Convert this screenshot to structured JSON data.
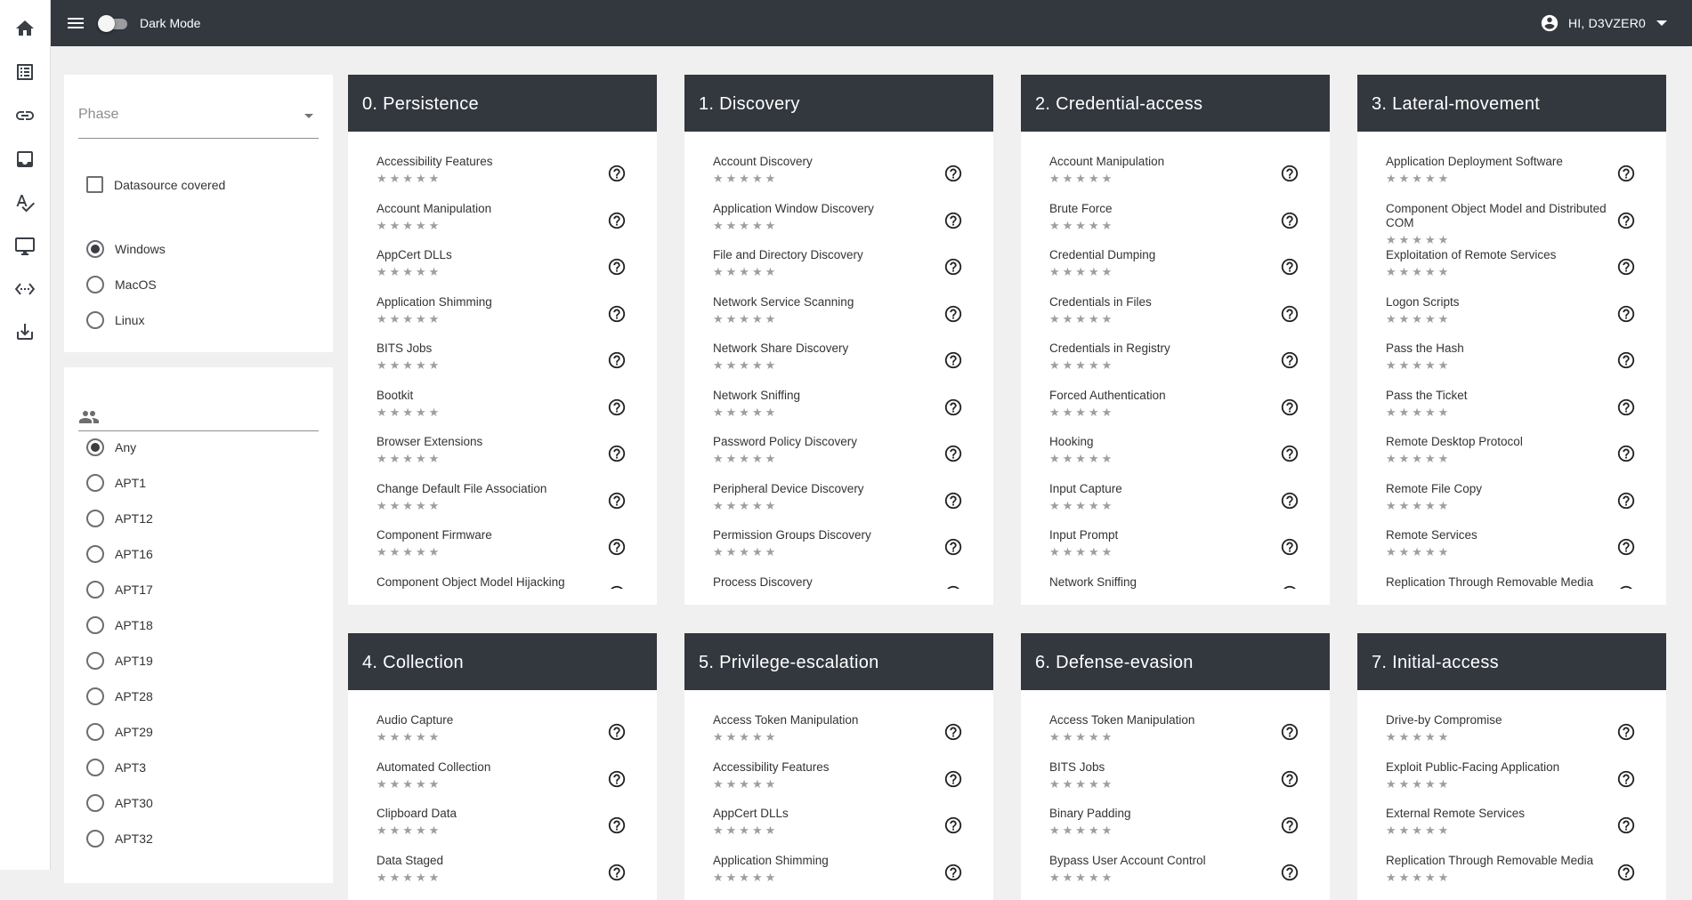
{
  "nav": {
    "items": [
      {
        "id": "home",
        "icon": "home-icon"
      },
      {
        "id": "list",
        "icon": "list-icon"
      },
      {
        "id": "link",
        "icon": "link-icon"
      },
      {
        "id": "inbox",
        "icon": "inbox-icon"
      },
      {
        "id": "spellcheck",
        "icon": "spellcheck-icon"
      },
      {
        "id": "desktop",
        "icon": "desktop-icon"
      },
      {
        "id": "code",
        "icon": "code-icon"
      },
      {
        "id": "download",
        "icon": "download-icon"
      }
    ]
  },
  "header": {
    "dark_mode_label": "Dark Mode",
    "dark_mode_on": false,
    "user_greeting": "HI, D3VZER0"
  },
  "filters": {
    "phase_placeholder": "Phase",
    "datasource_label": "Datasource covered",
    "datasource_checked": false,
    "os_options": [
      "Windows",
      "MacOS",
      "Linux"
    ],
    "os_selected": "Windows",
    "group_icon": "group-icon",
    "group_options": [
      "Any",
      "APT1",
      "APT12",
      "APT16",
      "APT17",
      "APT18",
      "APT19",
      "APT28",
      "APT29",
      "APT3",
      "APT30",
      "APT32"
    ],
    "group_selected": "Any"
  },
  "rating_stars": "★★★★★",
  "colors": {
    "header_bg": "#33373e",
    "card_head_bg": "#33373e",
    "page_bg": "#f0f0f0",
    "star_gray": "#9e9e9e"
  },
  "phases": [
    {
      "title": "0. Persistence",
      "techniques": [
        "Accessibility Features",
        "Account Manipulation",
        "AppCert DLLs",
        "Application Shimming",
        "BITS Jobs",
        "Bootkit",
        "Browser Extensions",
        "Change Default File Association",
        "Component Firmware",
        "Component Object Model Hijacking"
      ]
    },
    {
      "title": "1. Discovery",
      "techniques": [
        "Account Discovery",
        "Application Window Discovery",
        "File and Directory Discovery",
        "Network Service Scanning",
        "Network Share Discovery",
        "Network Sniffing",
        "Password Policy Discovery",
        "Peripheral Device Discovery",
        "Permission Groups Discovery",
        "Process Discovery"
      ]
    },
    {
      "title": "2. Credential-access",
      "techniques": [
        "Account Manipulation",
        "Brute Force",
        "Credential Dumping",
        "Credentials in Files",
        "Credentials in Registry",
        "Forced Authentication",
        "Hooking",
        "Input Capture",
        "Input Prompt",
        "Network Sniffing"
      ]
    },
    {
      "title": "3. Lateral-movement",
      "techniques": [
        "Application Deployment Software",
        "Component Object Model and Distributed COM",
        "Exploitation of Remote Services",
        "Logon Scripts",
        "Pass the Hash",
        "Pass the Ticket",
        "Remote Desktop Protocol",
        "Remote File Copy",
        "Remote Services",
        "Replication Through Removable Media"
      ]
    },
    {
      "title": "4. Collection",
      "techniques": [
        "Audio Capture",
        "Automated Collection",
        "Clipboard Data",
        "Data Staged"
      ]
    },
    {
      "title": "5. Privilege-escalation",
      "techniques": [
        "Access Token Manipulation",
        "Accessibility Features",
        "AppCert DLLs",
        "Application Shimming"
      ]
    },
    {
      "title": "6. Defense-evasion",
      "techniques": [
        "Access Token Manipulation",
        "BITS Jobs",
        "Binary Padding",
        "Bypass User Account Control"
      ]
    },
    {
      "title": "7. Initial-access",
      "techniques": [
        "Drive-by Compromise",
        "Exploit Public-Facing Application",
        "External Remote Services",
        "Replication Through Removable Media"
      ]
    }
  ]
}
